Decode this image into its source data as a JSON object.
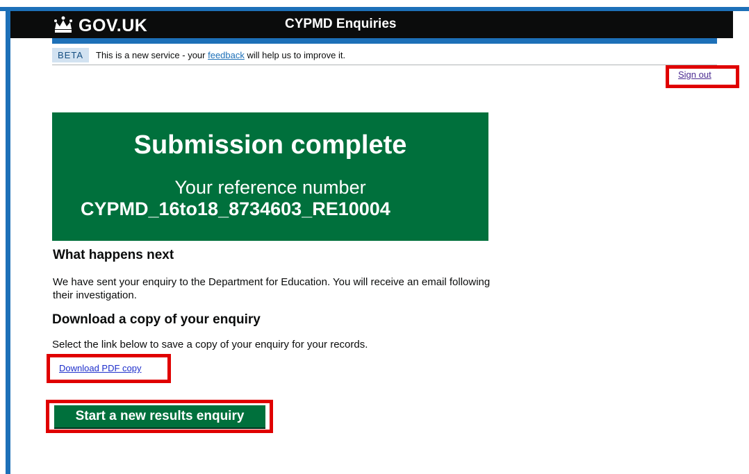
{
  "header": {
    "logo_text": "GOV.UK",
    "service_name": "CYPMD Enquiries"
  },
  "phase_banner": {
    "tag": "BETA",
    "text_before": "This is a new service - your ",
    "link_text": "feedback",
    "text_after": " will help us to improve it."
  },
  "account": {
    "sign_out": "Sign out"
  },
  "confirmation": {
    "title": "Submission complete",
    "body": "Your reference number",
    "reference": "CYPMD_16to18_8734603_RE10004"
  },
  "next_steps": {
    "heading": "What happens next",
    "text": "We have sent your enquiry to the Department for Education. You will receive an email following their investigation."
  },
  "download": {
    "heading": "Download a copy of your enquiry",
    "text": "Select the link below to save a copy of your enquiry for your records.",
    "link": "Download PDF copy"
  },
  "actions": {
    "start_new": "Start a new results enquiry"
  },
  "colors": {
    "govuk_blue": "#1d70b8",
    "header_black": "#0b0c0c",
    "success_green": "#00703c",
    "highlight_red": "#e00000"
  }
}
